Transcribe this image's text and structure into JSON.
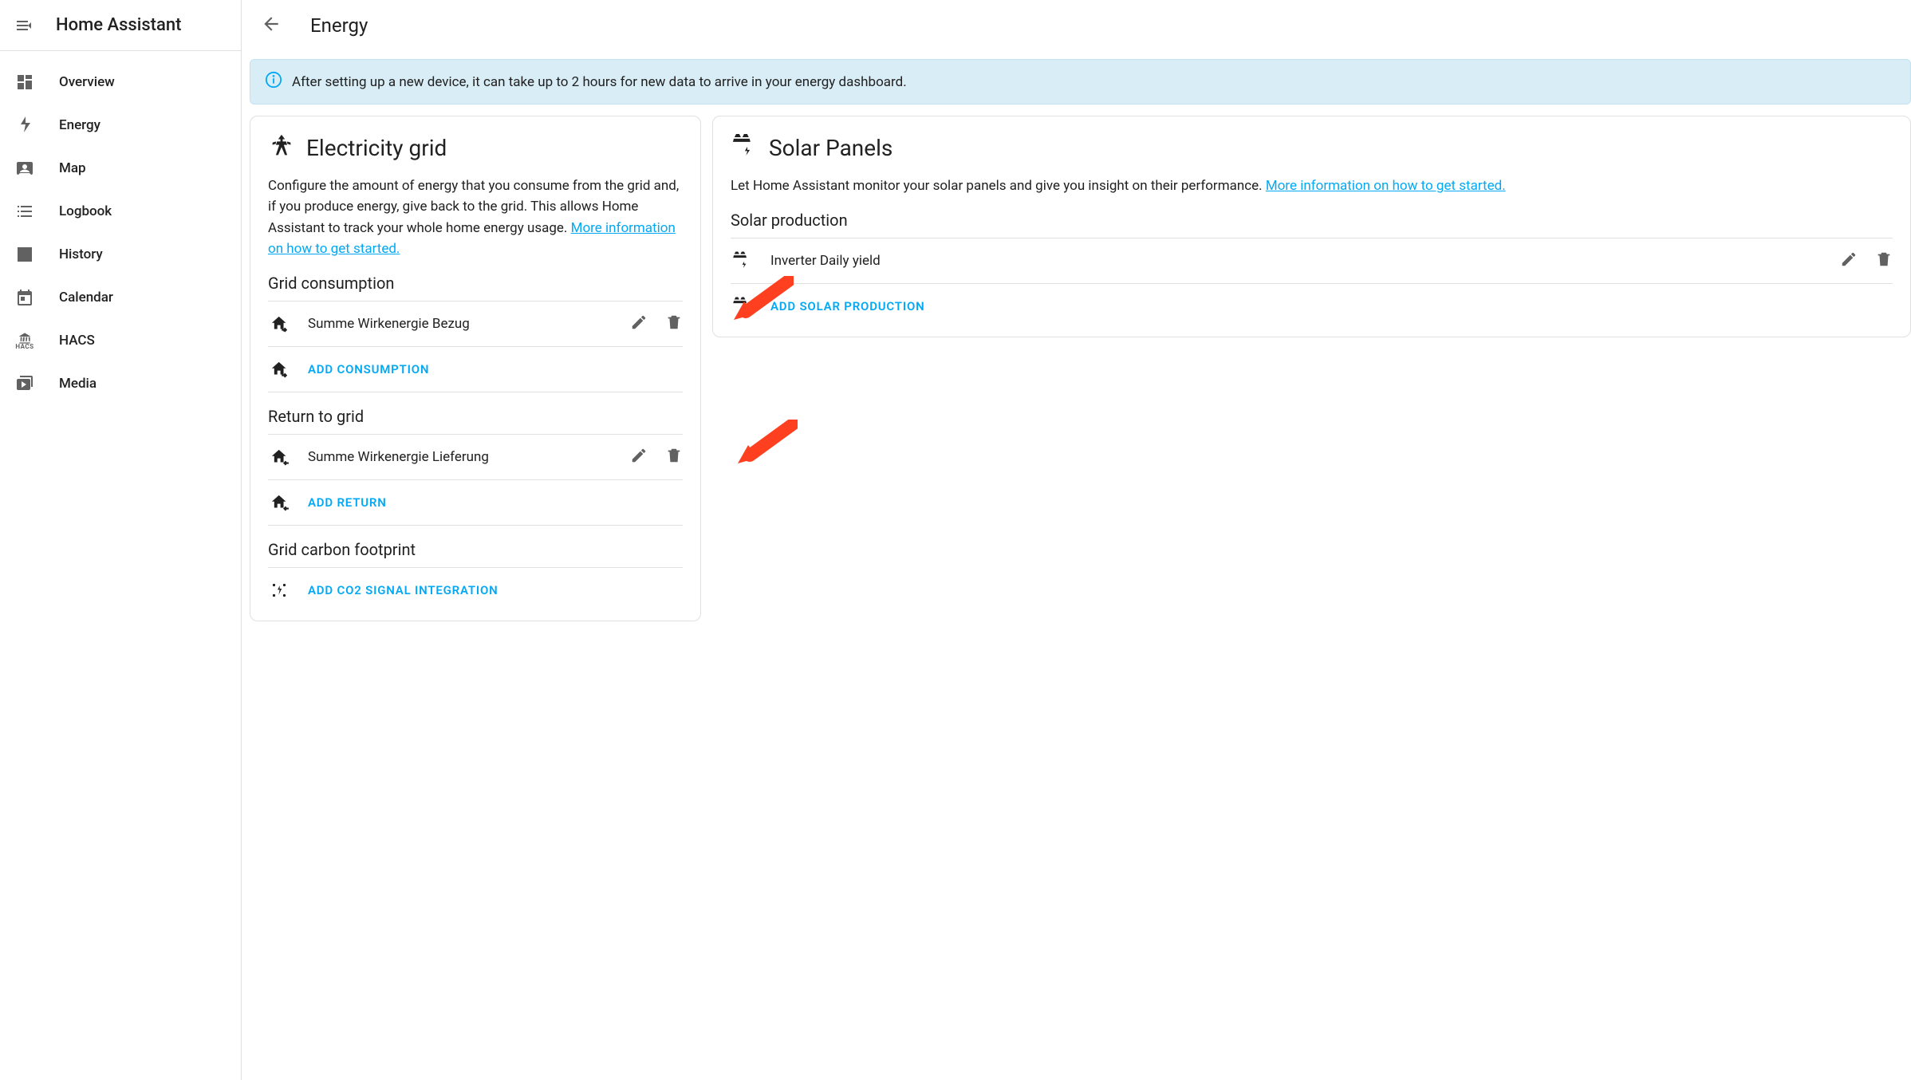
{
  "app_title": "Home Assistant",
  "page_title": "Energy",
  "alert_text": "After setting up a new device, it can take up to 2 hours for new data to arrive in your energy dashboard.",
  "nav": [
    {
      "label": "Overview",
      "icon": "dashboard"
    },
    {
      "label": "Energy",
      "icon": "flash"
    },
    {
      "label": "Map",
      "icon": "account-box"
    },
    {
      "label": "Logbook",
      "icon": "list"
    },
    {
      "label": "History",
      "icon": "chart"
    },
    {
      "label": "Calendar",
      "icon": "calendar"
    },
    {
      "label": "HACS",
      "icon": "hacs"
    },
    {
      "label": "Media",
      "icon": "play-box"
    }
  ],
  "grid_card": {
    "title": "Electricity grid",
    "description_pre": "Configure the amount of energy that you consume from the grid and, if you produce energy, give back to the grid. This allows Home Assistant to track your whole home energy usage. ",
    "link_text": "More information on how to get started.",
    "consumption_heading": "Grid consumption",
    "consumption_item": "Summe Wirkenergie Bezug",
    "add_consumption": "Add Consumption",
    "return_heading": "Return to grid",
    "return_item": "Summe Wirkenergie Lieferung",
    "add_return": "Add Return",
    "carbon_heading": "Grid carbon footprint",
    "add_co2": "Add CO2 signal integration"
  },
  "solar_card": {
    "title": "Solar Panels",
    "description_pre": "Let Home Assistant monitor your solar panels and give you insight on their performance. ",
    "link_text": "More information on how to get started.",
    "production_heading": "Solar production",
    "production_item": "Inverter Daily yield",
    "add_production": "Add Solar Production"
  }
}
